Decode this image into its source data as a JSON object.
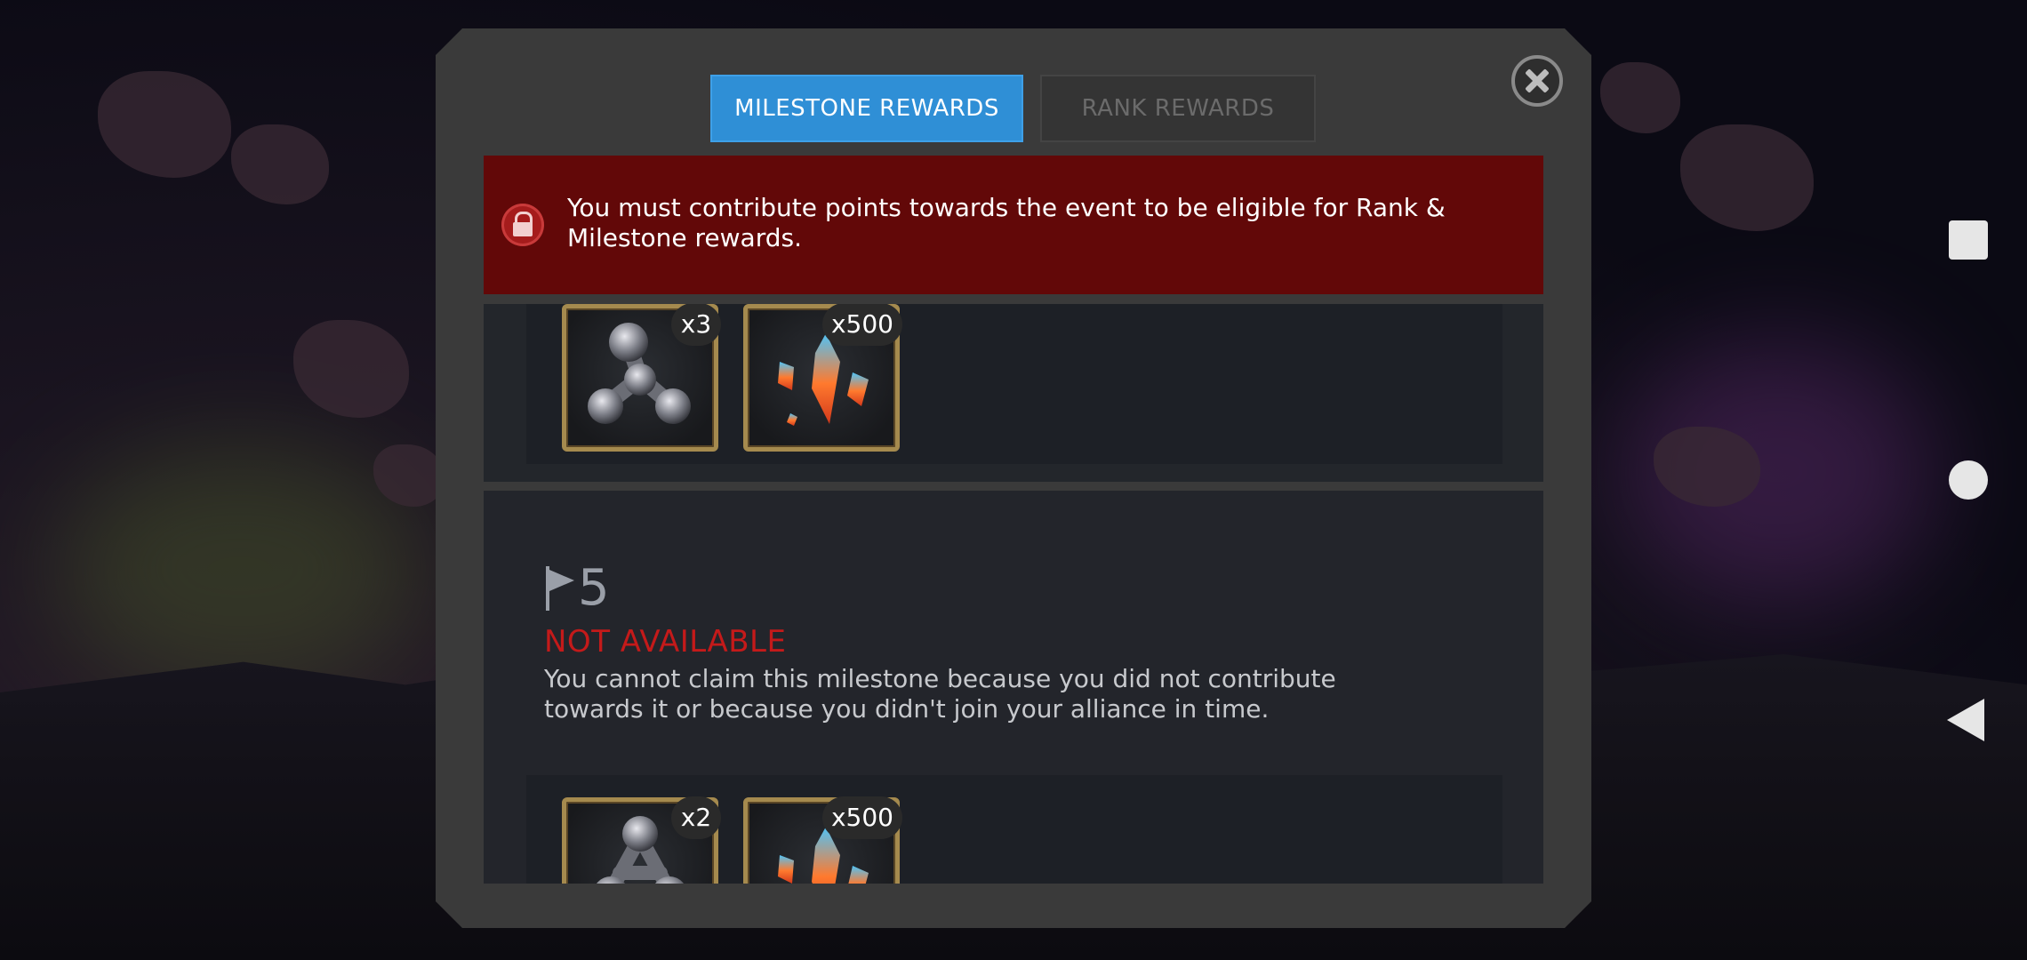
{
  "tabs": {
    "milestone_label": "MILESTONE REWARDS",
    "rank_label": "RANK REWARDS"
  },
  "banner": {
    "message": "You must contribute points towards the event to be eligible for Rank & Milestone rewards."
  },
  "milestone_top": {
    "rewards": [
      {
        "icon": "catalyst-icon",
        "count": "x3"
      },
      {
        "icon": "crystal-shards-icon",
        "count": "x500"
      }
    ]
  },
  "milestone_5": {
    "number": "5",
    "status": "NOT AVAILABLE",
    "description": "You cannot claim this milestone because you did not contribute towards it or because you didn't join your alliance in time.",
    "rewards": [
      {
        "icon": "catalyst-icon",
        "count": "x2"
      },
      {
        "icon": "crystal-shards-icon",
        "count": "x500"
      }
    ]
  },
  "colors": {
    "active_tab": "#2f8fd6",
    "banner_bg": "#620808",
    "not_available": "#c41a1a"
  }
}
